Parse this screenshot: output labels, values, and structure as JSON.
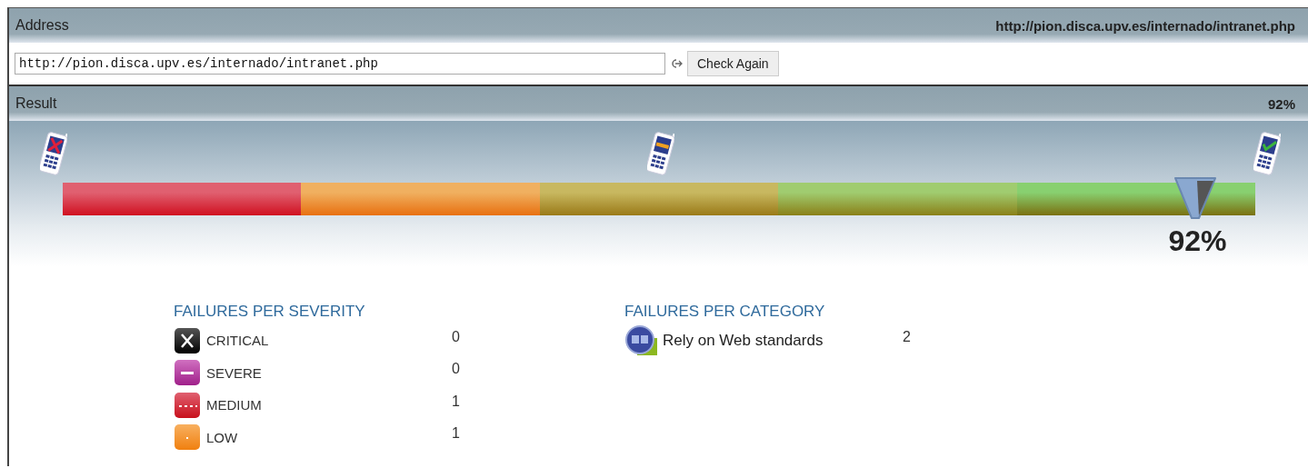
{
  "address": {
    "title": "Address",
    "url_label": "http://pion.disca.upv.es/internado/intranet.php",
    "value": "http://pion.disca.upv.es/internado/intranet.php",
    "button": "Check Again"
  },
  "result": {
    "title": "Result",
    "score": "92%",
    "phones": [
      {
        "kind": "fail"
      },
      {
        "kind": "partial"
      },
      {
        "kind": "pass"
      }
    ],
    "gauge": {
      "level": 0.95,
      "reading": "92%"
    }
  },
  "severity": {
    "title": "FAILURES PER SEVERITY",
    "rows": [
      {
        "kind": "critical",
        "label": "CRITICAL",
        "count": "0"
      },
      {
        "kind": "severe",
        "label": "SEVERE",
        "count": "0"
      },
      {
        "kind": "medium",
        "label": "MEDIUM",
        "count": "1"
      },
      {
        "kind": "low",
        "label": "LOW",
        "count": "1"
      }
    ]
  },
  "category": {
    "title": "FAILURES PER CATEGORY",
    "rows": [
      {
        "label": "Rely on Web standards",
        "count": "2"
      }
    ]
  }
}
